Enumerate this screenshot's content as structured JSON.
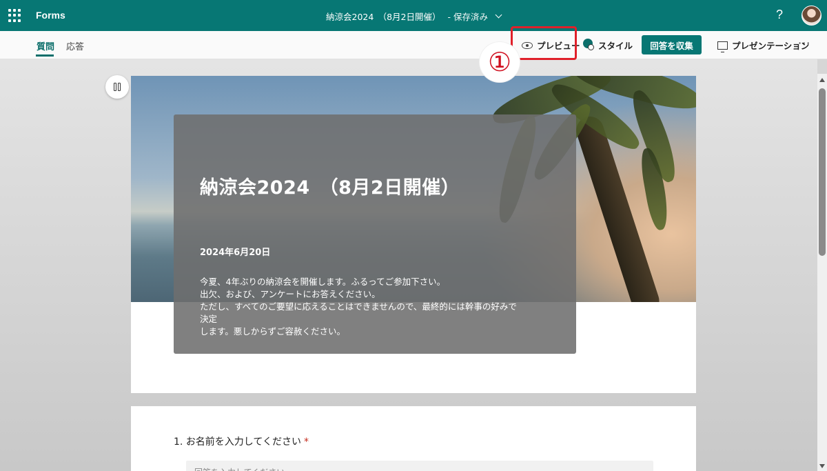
{
  "app": {
    "name": "Forms"
  },
  "document": {
    "title": "納涼会2024　（8月2日開催）",
    "save_status": "-  保存済み"
  },
  "tabs": [
    {
      "label": "質問",
      "active": true
    },
    {
      "label": "応答",
      "active": false
    }
  ],
  "toolbar": {
    "preview_label": "プレビュー",
    "style_label": "スタイル",
    "collect_label": "回答を収集",
    "present_label": "プレゼンテーション",
    "more_label": "···"
  },
  "topbar": {
    "help_label": "?"
  },
  "annotation": {
    "marker": "①",
    "color": "#e0202a"
  },
  "form": {
    "title": "納涼会2024　（8月2日開催）",
    "date": "2024年6月20日",
    "description": [
      "今夏、4年ぶりの納涼会を開催します。ふるってご参加下さい。",
      "出欠、および、アンケートにお答えください。",
      "ただし、すべてのご要望に応えることはできませんので、最終的には幹事の好みで決定",
      "します。悪しからずご容赦ください。"
    ]
  },
  "questions": [
    {
      "number": "1.",
      "text": "お名前を入力してください",
      "required_mark": "*",
      "placeholder": "回答を入力してください"
    }
  ],
  "colors": {
    "brand": "#077774",
    "accent": "#0b6e6a"
  }
}
